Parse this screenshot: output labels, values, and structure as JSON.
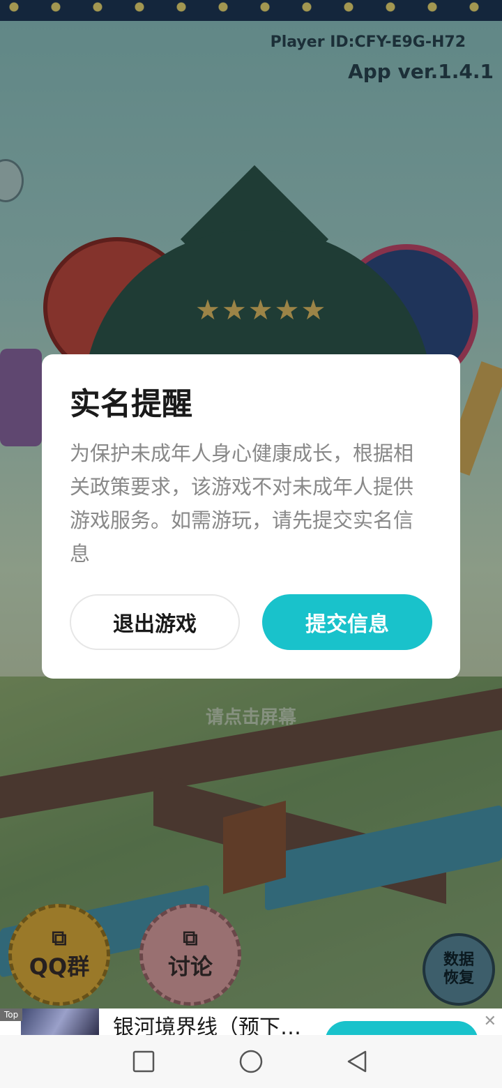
{
  "game": {
    "player_id": "Player ID:CFY-E9G-H72",
    "app_version": "App ver.1.4.1",
    "tap_hint": "请点击屏幕",
    "qq_group_label": "QQ群",
    "discussion_label": "讨论",
    "data_restore_label_line1": "数据",
    "data_restore_label_line2": "恢复"
  },
  "dialog": {
    "title": "实名提醒",
    "body": "为保护未成年人身心健康成长，根据相关政策要求，该游戏不对未成年人提供游戏服务。如需游玩，请先提交实名信息",
    "exit_label": "退出游戏",
    "submit_label": "提交信息"
  },
  "ad": {
    "tag": "Top",
    "title": "银河境界线（预下…"
  },
  "nav": {
    "recent_icon": "square-icon",
    "home_icon": "circle-icon",
    "back_icon": "triangle-back-icon"
  }
}
